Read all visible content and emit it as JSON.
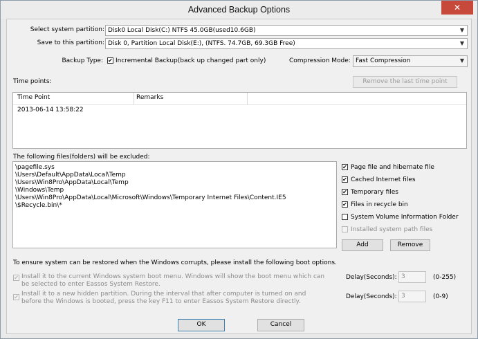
{
  "window": {
    "title": "Advanced Backup Options",
    "close_glyph": "✕"
  },
  "partitions": {
    "system_label": "Select system partition:",
    "system_value": "Disk0  Local Disk(C:) NTFS 45.0GB(used10.6GB)",
    "save_label": "Save to this partition:",
    "save_value": "Disk 0, Partition Local Disk(E:), (NTFS. 74.7GB, 69.3GB Free)"
  },
  "backup": {
    "type_label": "Backup Type:",
    "incremental_checked": true,
    "incremental_label": "Incremental Backup(back up changed part only)",
    "compression_label": "Compression Mode:",
    "compression_value": "Fast Compression"
  },
  "time_points": {
    "label": "Time points:",
    "remove_button": "Remove the last time point",
    "columns": [
      "Time Point",
      "Remarks"
    ],
    "rows": [
      {
        "time": "2013-06-14 13:58:22",
        "remarks": ""
      }
    ]
  },
  "excluded": {
    "label": "The following files(folders) will be excluded:",
    "lines": [
      "\\pagefile.sys",
      "\\Users\\Default\\AppData\\Local\\Temp",
      "\\Users\\Win8Pro\\AppData\\Local\\Temp",
      "\\Windows\\Temp",
      "\\Users\\Win8Pro\\AppData\\Local\\Microsoft\\Windows\\Temporary Internet Files\\Content.IE5",
      "\\$Recycle.bin\\*"
    ],
    "options": [
      {
        "label": "Page file and hibernate file",
        "checked": true,
        "enabled": true
      },
      {
        "label": "Cached Internet files",
        "checked": true,
        "enabled": true
      },
      {
        "label": "Temporary files",
        "checked": true,
        "enabled": true
      },
      {
        "label": "Files in recycle bin",
        "checked": true,
        "enabled": true
      },
      {
        "label": "System Volume Information Folder",
        "checked": false,
        "enabled": true
      },
      {
        "label": "Installed system path files",
        "checked": false,
        "enabled": false
      }
    ],
    "add_button": "Add",
    "remove_button": "Remove"
  },
  "boot": {
    "intro": "To ensure system can be restored when the Windows corrupts, please install the following boot options.",
    "menu_option": {
      "checked": true,
      "text": "Install it to the current Windows system boot menu. Windows will show the boot menu which can be selected to enter Eassos System Restore.",
      "delay_label": "Delay(Seconds):",
      "delay_value": "3",
      "range": "(0-255)"
    },
    "partition_option": {
      "checked": true,
      "text": "Install it to a new hidden partition. During the interval that after computer is turned on and before the Windows is booted, press the key F11 to enter Eassos System Restore directly.",
      "delay_label": "Delay(Seconds):",
      "delay_value": "3",
      "range": "(0-9)"
    }
  },
  "footer": {
    "ok": "OK",
    "cancel": "Cancel"
  },
  "icons": {
    "check": "✔",
    "caret": "▼"
  }
}
